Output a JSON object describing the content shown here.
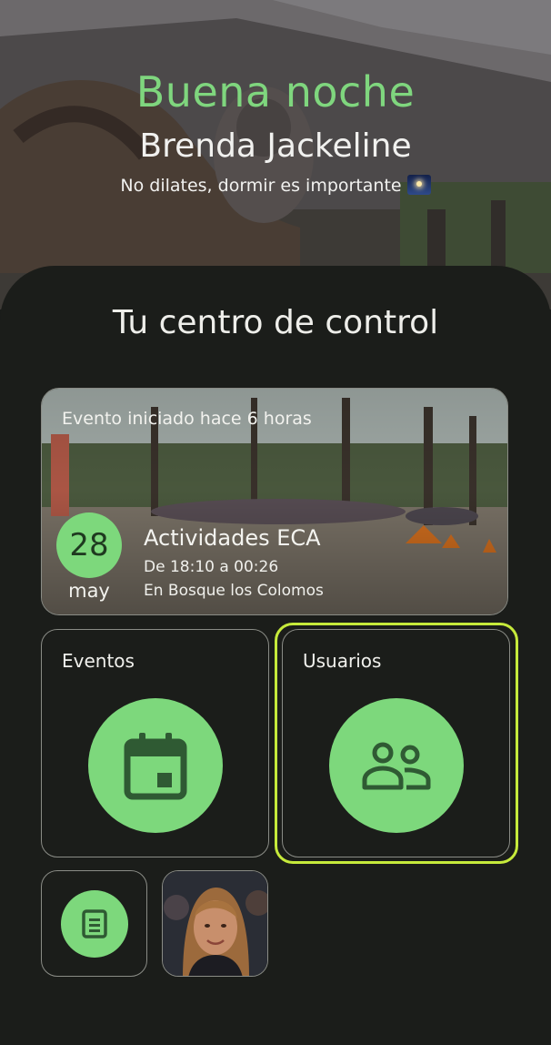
{
  "header": {
    "greeting": "Buena noche",
    "user_name": "Brenda Jackeline",
    "message": "No dilates, dormir es importante",
    "message_icon": "night-sky-icon"
  },
  "panel": {
    "title": "Tu centro de control"
  },
  "event": {
    "status": "Evento iniciado hace 6 horas",
    "day": "28",
    "month": "may",
    "name": "Actividades ECA",
    "time": "De 18:10 a 00:26",
    "place": "En Bosque los Colomos"
  },
  "tiles": {
    "events": {
      "label": "Eventos",
      "icon": "calendar-icon"
    },
    "users": {
      "label": "Usuarios",
      "icon": "people-icon",
      "selected": true
    },
    "small": {
      "icon": "document-icon"
    },
    "avatar": {
      "icon": "profile-photo"
    }
  },
  "colors": {
    "accent_green": "#7dd87c",
    "selection": "#c6ea3b",
    "background": "#1b1d1a",
    "icon_dark": "#2f5a33"
  }
}
